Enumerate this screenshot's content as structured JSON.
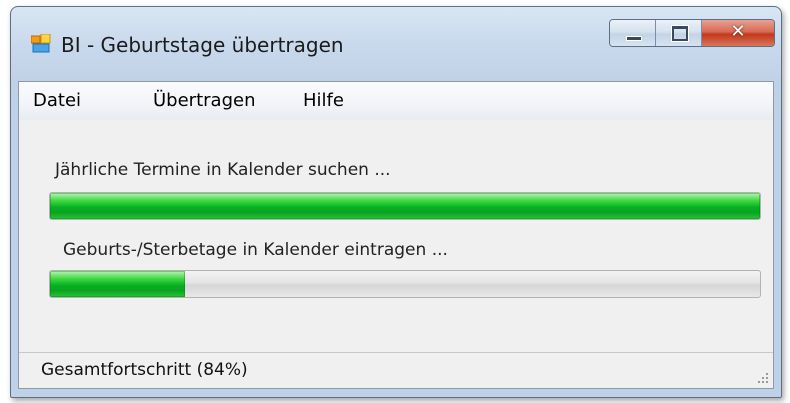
{
  "window": {
    "title": "BI - Geburtstage übertragen"
  },
  "menu": [
    {
      "label": "Datei"
    },
    {
      "label": "Übertragen"
    },
    {
      "label": "Hilfe"
    }
  ],
  "tasks": [
    {
      "label": "Jährliche Termine in Kalender suchen ...",
      "progress": 1.0
    },
    {
      "label": "Geburts-/Sterbetage in Kalender eintragen ...",
      "progress": 0.19
    }
  ],
  "status": {
    "text": "Gesamtfortschritt (84%)"
  },
  "colors": {
    "progress_green": "#06b025",
    "close_red": "#c2391c",
    "frame_blue": "#c9d9ec"
  },
  "icons": {
    "app": "app-window-icon",
    "minimize": "minimize-icon",
    "maximize": "maximize-icon",
    "close": "close-icon",
    "grip": "resize-grip-icon"
  }
}
